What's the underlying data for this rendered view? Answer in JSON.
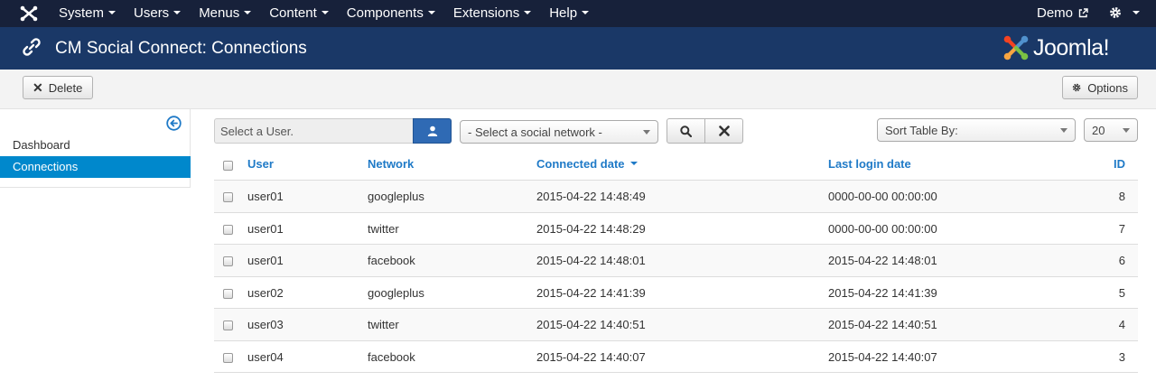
{
  "navbar": {
    "menu": [
      "System",
      "Users",
      "Menus",
      "Content",
      "Components",
      "Extensions",
      "Help"
    ],
    "site_link": "Demo"
  },
  "header": {
    "title": "CM Social Connect: Connections",
    "brand": "Joomla!"
  },
  "toolbar": {
    "delete_label": "Delete",
    "options_label": "Options"
  },
  "sidebar": {
    "items": [
      {
        "label": "Dashboard",
        "active": false
      },
      {
        "label": "Connections",
        "active": true
      }
    ]
  },
  "filters": {
    "user_placeholder": "Select a User.",
    "network_select": "- Select a social network -",
    "sort_select": "Sort Table By:",
    "limit_select": "20"
  },
  "table": {
    "columns": [
      "User",
      "Network",
      "Connected date",
      "Last login date",
      "ID"
    ],
    "rows": [
      {
        "user": "user01",
        "network": "googleplus",
        "connected": "2015-04-22 14:48:49",
        "last_login": "0000-00-00 00:00:00",
        "id": "8"
      },
      {
        "user": "user01",
        "network": "twitter",
        "connected": "2015-04-22 14:48:29",
        "last_login": "0000-00-00 00:00:00",
        "id": "7"
      },
      {
        "user": "user01",
        "network": "facebook",
        "connected": "2015-04-22 14:48:01",
        "last_login": "2015-04-22 14:48:01",
        "id": "6"
      },
      {
        "user": "user02",
        "network": "googleplus",
        "connected": "2015-04-22 14:41:39",
        "last_login": "2015-04-22 14:41:39",
        "id": "5"
      },
      {
        "user": "user03",
        "network": "twitter",
        "connected": "2015-04-22 14:40:51",
        "last_login": "2015-04-22 14:40:51",
        "id": "4"
      },
      {
        "user": "user04",
        "network": "facebook",
        "connected": "2015-04-22 14:40:07",
        "last_login": "2015-04-22 14:40:07",
        "id": "3"
      }
    ]
  },
  "colors": {
    "navbar_bg": "#17213a",
    "header_bg": "#1a3867",
    "link_blue": "#1f7ac7",
    "active_blue": "#0088cc"
  },
  "icons": [
    "joomla-logo-icon",
    "caret-down-icon",
    "external-link-icon",
    "gear-icon",
    "link-icon",
    "close-icon",
    "collapse-sidebar-icon",
    "user-icon",
    "search-icon"
  ]
}
